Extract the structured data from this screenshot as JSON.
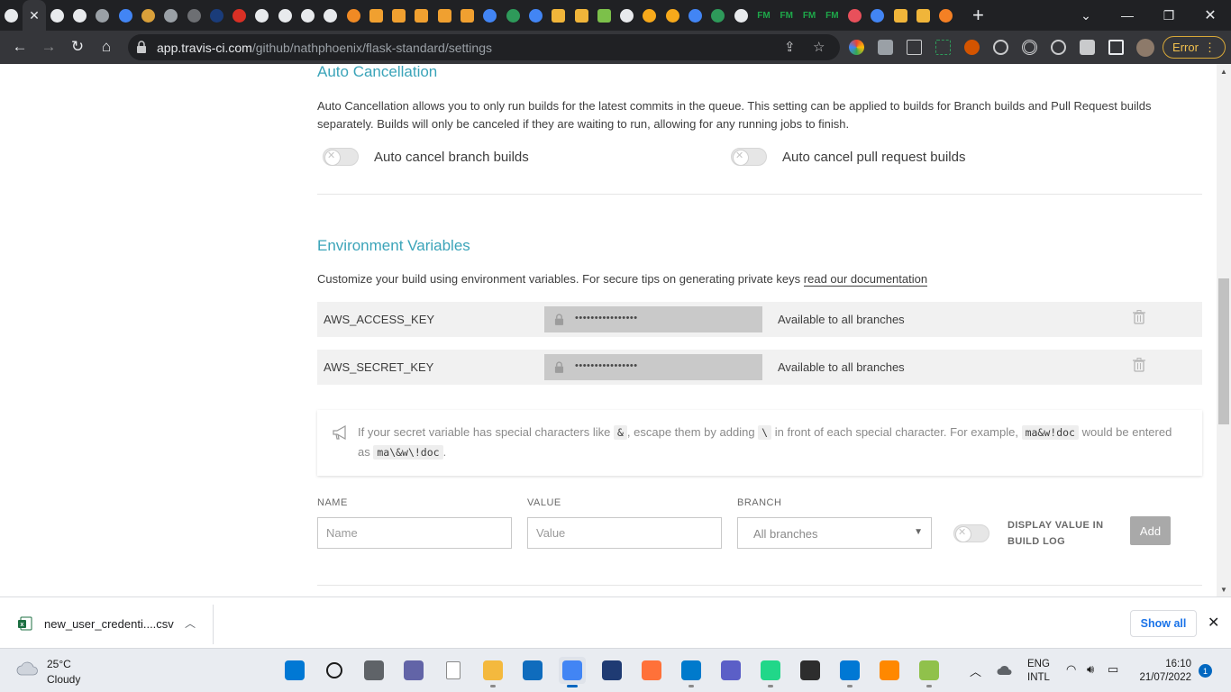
{
  "browser": {
    "tab_favicons": [
      {
        "icon": "github-icon",
        "color": "#e8eaed"
      },
      {
        "icon": "github-icon",
        "color": "#e8eaed"
      },
      {
        "icon": "github-icon",
        "color": "#e8eaed"
      },
      {
        "icon": "github-icon",
        "color": "#e8eaed"
      },
      {
        "icon": "globe-icon",
        "color": "#9aa0a6"
      },
      {
        "icon": "google-icon",
        "color": "#4285f4"
      },
      {
        "icon": "mascot-icon",
        "color": "#d9a03a"
      },
      {
        "icon": "globe-icon",
        "color": "#9aa0a6"
      },
      {
        "icon": "globe-icon",
        "color": "#6d6f73"
      },
      {
        "icon": "edge-icon",
        "color": "#1a3c7a"
      },
      {
        "icon": "opera-icon",
        "color": "#d93025"
      },
      {
        "icon": "history-icon",
        "color": "#e8eaed"
      },
      {
        "icon": "github-icon",
        "color": "#e8eaed"
      },
      {
        "icon": "github-icon",
        "color": "#e8eaed"
      },
      {
        "icon": "github-icon",
        "color": "#e8eaed"
      },
      {
        "icon": "amazon-icon",
        "color": "#f08a24"
      },
      {
        "icon": "doc-icon",
        "color": "#f0a030"
      },
      {
        "icon": "doc-icon",
        "color": "#f0a030"
      },
      {
        "icon": "doc-icon",
        "color": "#f0a030"
      },
      {
        "icon": "book-icon",
        "color": "#f0a030"
      },
      {
        "icon": "book-icon",
        "color": "#f0a030"
      },
      {
        "icon": "google-icon",
        "color": "#4285f4"
      },
      {
        "icon": "leetcode-icon",
        "color": "#2e9a5a"
      },
      {
        "icon": "colab-icon",
        "color": "#4285f4"
      },
      {
        "icon": "box-icon",
        "color": "#f0b53a"
      },
      {
        "icon": "box-icon",
        "color": "#f0b53a"
      },
      {
        "icon": "key-icon",
        "color": "#7cc04a"
      },
      {
        "icon": "chrome-icon",
        "color": "#e8eaed"
      },
      {
        "icon": "star-badge-icon",
        "color": "#f6a91b"
      },
      {
        "icon": "star-badge-icon",
        "color": "#f6a91b"
      },
      {
        "icon": "google-icon",
        "color": "#4285f4"
      },
      {
        "icon": "leetcode-icon",
        "color": "#2e9a5a"
      },
      {
        "icon": "settings-icon",
        "color": "#e8eaed"
      },
      {
        "icon": "fm-icon",
        "color": "#1ea84a"
      },
      {
        "icon": "fm-icon",
        "color": "#1ea84a"
      },
      {
        "icon": "fm-icon",
        "color": "#1ea84a"
      },
      {
        "icon": "fm-icon",
        "color": "#1ea84a"
      },
      {
        "icon": "feather-icon",
        "color": "#e8505b"
      },
      {
        "icon": "google-icon",
        "color": "#4285f4"
      },
      {
        "icon": "box-icon",
        "color": "#f0b53a"
      },
      {
        "icon": "box-icon",
        "color": "#f0b53a"
      },
      {
        "icon": "stack-overflow-icon",
        "color": "#f48024"
      }
    ],
    "fm_text": "FM",
    "url_host": "app.travis-ci.com",
    "url_path": "/github/nathphoenix/flask-standard/settings",
    "error_label": "Error"
  },
  "page": {
    "auto_cancel": {
      "title": "Auto Cancellation",
      "description": "Auto Cancellation allows you to only run builds for the latest commits in the queue. This setting can be applied to builds for Branch builds and Pull Request builds separately. Builds will only be canceled if they are waiting to run, allowing for any running jobs to finish.",
      "branch_label": "Auto cancel branch builds",
      "pr_label": "Auto cancel pull request builds"
    },
    "env": {
      "title": "Environment Variables",
      "description_prefix": "Customize your build using environment variables. For secure tips on generating private keys ",
      "doc_link": "read our documentation",
      "rows": [
        {
          "name": "AWS_ACCESS_KEY",
          "value": "••••••••••••••••",
          "branch": "Available to all branches"
        },
        {
          "name": "AWS_SECRET_KEY",
          "value": "••••••••••••••••",
          "branch": "Available to all branches"
        }
      ],
      "notice": {
        "t1": "If your secret variable has special characters like ",
        "c1": "&",
        "t2": ", escape them by adding ",
        "c2": "\\",
        "t3": " in front of each special character. For example, ",
        "c3": "ma&w!doc",
        "t4": " would be entered as ",
        "c4": "ma\\&w\\!doc",
        "t5": "."
      },
      "form": {
        "name_label": "NAME",
        "name_placeholder": "Name",
        "value_label": "VALUE",
        "value_placeholder": "Value",
        "branch_label": "BRANCH",
        "branch_value": "All branches",
        "display_label": "DISPLAY VALUE IN BUILD LOG",
        "add_label": "Add"
      }
    }
  },
  "download": {
    "filename": "new_user_credenti....csv",
    "show_all": "Show all"
  },
  "taskbar": {
    "temp": "25°C",
    "weather": "Cloudy",
    "lang_1": "ENG",
    "lang_2": "INTL",
    "time": "16:10",
    "date": "21/07/2022",
    "notifications": "1"
  }
}
